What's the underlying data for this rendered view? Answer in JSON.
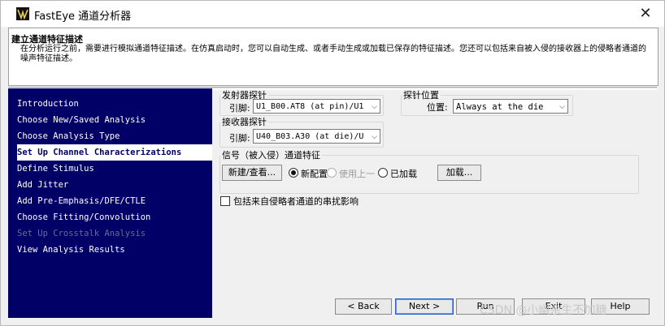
{
  "window": {
    "title": "FastEye 通道分析器",
    "close_glyph": "✕"
  },
  "header": {
    "title": "建立通道特征描述",
    "description": "在分析运行之前，需要进行模拟通道特征描述。在仿真启动时，您可以自动生成、或者手动生成或加载已保存的特征描述。您还可以包括来自被入侵的接收器上的侵略者通道的噪声特征描述。"
  },
  "nav": {
    "items": [
      {
        "label": "Introduction",
        "state": "normal"
      },
      {
        "label": "Choose New/Saved Analysis",
        "state": "normal"
      },
      {
        "label": "Choose Analysis Type",
        "state": "normal"
      },
      {
        "label": "Set Up Channel Characterizations",
        "state": "active"
      },
      {
        "label": "Define Stimulus",
        "state": "normal"
      },
      {
        "label": "Add Jitter",
        "state": "normal"
      },
      {
        "label": "Add Pre-Emphasis/DFE/CTLE",
        "state": "normal"
      },
      {
        "label": "Choose Fitting/Convolution",
        "state": "normal"
      },
      {
        "label": "Set Up Crosstalk Analysis",
        "state": "disabled"
      },
      {
        "label": "View Analysis Results",
        "state": "normal"
      }
    ]
  },
  "transmitter_probe": {
    "legend": "发射器探针",
    "pin_label": "引脚:",
    "pin_value": "U1_B00.AT8 (at pin)/U1"
  },
  "probe_position": {
    "legend": "探针位置",
    "position_label": "位置:",
    "position_value": "Always at the die"
  },
  "receiver_probe": {
    "legend": "接收器探针",
    "pin_label": "引脚:",
    "pin_value": "U40_B03.A30 (at die)/U"
  },
  "channel_char": {
    "legend": "信号（被入侵）通道特征",
    "new_view_button": "新建/查看...",
    "radio_new": "新配置",
    "radio_use_last": "使用上一",
    "radio_loaded": "已加载",
    "load_button": "加载..."
  },
  "crosstalk_checkbox_label": "包括来自侵略者通道的串扰影响",
  "footer": {
    "back": "< Back",
    "next": "Next >",
    "run": "Run",
    "exit": "Exit",
    "help": "Help"
  },
  "watermark": "CSDN @小幽余生不加糖",
  "icons": {
    "combo_arrow": "chevron-down-icon"
  }
}
